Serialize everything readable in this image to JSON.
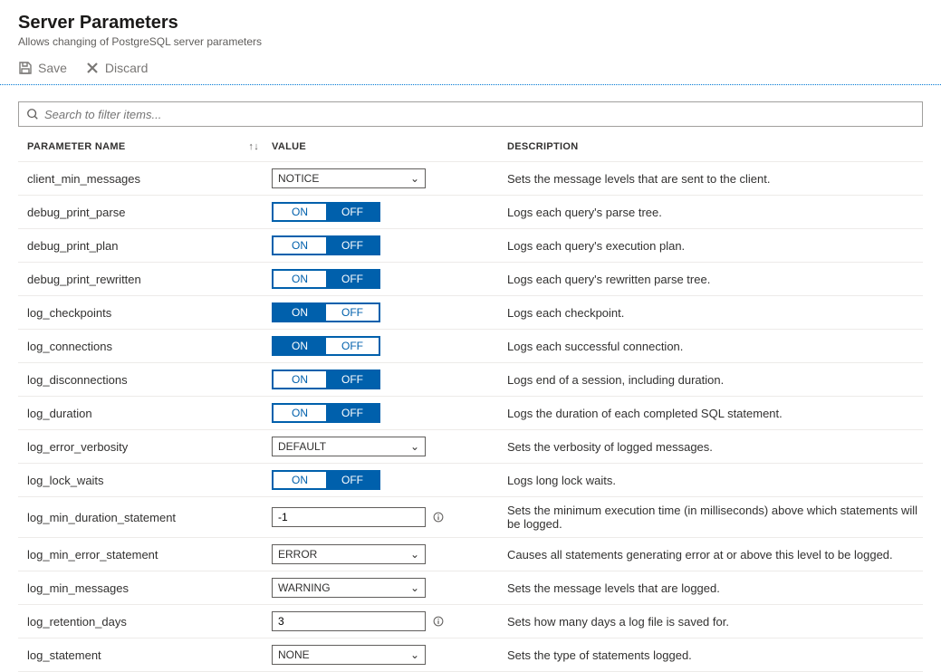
{
  "header": {
    "title": "Server Parameters",
    "subtitle": "Allows changing of PostgreSQL server parameters"
  },
  "toolbar": {
    "save_label": "Save",
    "discard_label": "Discard"
  },
  "search": {
    "placeholder": "Search to filter items..."
  },
  "columns": {
    "name": "PARAMETER NAME",
    "value": "VALUE",
    "description": "DESCRIPTION"
  },
  "rows": [
    {
      "name": "client_min_messages",
      "type": "select",
      "value": "NOTICE",
      "desc": "Sets the message levels that are sent to the client."
    },
    {
      "name": "debug_print_parse",
      "type": "toggle",
      "value": "OFF",
      "desc": "Logs each query's parse tree."
    },
    {
      "name": "debug_print_plan",
      "type": "toggle",
      "value": "OFF",
      "desc": "Logs each query's execution plan."
    },
    {
      "name": "debug_print_rewritten",
      "type": "toggle",
      "value": "OFF",
      "desc": "Logs each query's rewritten parse tree."
    },
    {
      "name": "log_checkpoints",
      "type": "toggle",
      "value": "ON",
      "desc": "Logs each checkpoint."
    },
    {
      "name": "log_connections",
      "type": "toggle",
      "value": "ON",
      "desc": "Logs each successful connection."
    },
    {
      "name": "log_disconnections",
      "type": "toggle",
      "value": "OFF",
      "desc": "Logs end of a session, including duration."
    },
    {
      "name": "log_duration",
      "type": "toggle",
      "value": "OFF",
      "desc": "Logs the duration of each completed SQL statement."
    },
    {
      "name": "log_error_verbosity",
      "type": "select",
      "value": "DEFAULT",
      "desc": "Sets the verbosity of logged messages."
    },
    {
      "name": "log_lock_waits",
      "type": "toggle",
      "value": "OFF",
      "desc": "Logs long lock waits."
    },
    {
      "name": "log_min_duration_statement",
      "type": "text",
      "value": "-1",
      "info": true,
      "desc": "Sets the minimum execution time (in milliseconds) above which statements will be logged."
    },
    {
      "name": "log_min_error_statement",
      "type": "select",
      "value": "ERROR",
      "desc": "Causes all statements generating error at or above this level to be logged."
    },
    {
      "name": "log_min_messages",
      "type": "select",
      "value": "WARNING",
      "desc": "Sets the message levels that are logged."
    },
    {
      "name": "log_retention_days",
      "type": "text",
      "value": "3",
      "info": true,
      "desc": "Sets how many days a log file is saved for."
    },
    {
      "name": "log_statement",
      "type": "select",
      "value": "NONE",
      "desc": "Sets the type of statements logged."
    }
  ],
  "toggle_labels": {
    "on": "ON",
    "off": "OFF"
  }
}
